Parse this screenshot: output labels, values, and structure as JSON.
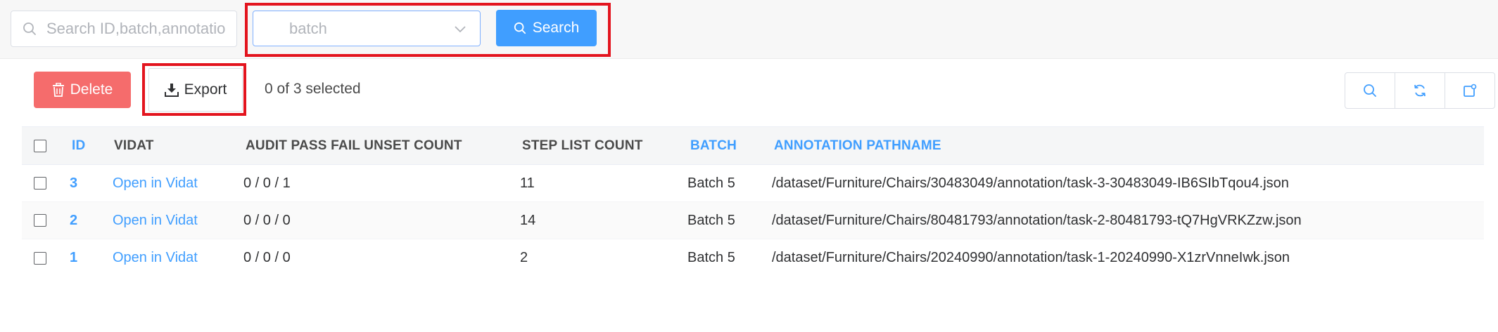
{
  "search": {
    "placeholder": "Search ID,batch,annotatio",
    "select_placeholder": "batch",
    "search_button": "Search"
  },
  "toolbar": {
    "delete_label": "Delete",
    "export_label": "Export",
    "selection_status": "0 of 3 selected"
  },
  "table": {
    "headers": {
      "id": "ID",
      "vidat": "VIDAT",
      "audit": "AUDIT PASS FAIL UNSET COUNT",
      "step": "STEP LIST COUNT",
      "batch": "BATCH",
      "pathname": "ANNOTATION PATHNAME"
    },
    "rows": [
      {
        "id": "3",
        "vidat": "Open in Vidat",
        "audit": "0 / 0 / 1",
        "step": "11",
        "batch": "Batch 5",
        "pathname": "/dataset/Furniture/Chairs/30483049/annotation/task-3-30483049-IB6SIbTqou4.json"
      },
      {
        "id": "2",
        "vidat": "Open in Vidat",
        "audit": "0 / 0 / 0",
        "step": "14",
        "batch": "Batch 5",
        "pathname": "/dataset/Furniture/Chairs/80481793/annotation/task-2-80481793-tQ7HgVRKZzw.json"
      },
      {
        "id": "1",
        "vidat": "Open in Vidat",
        "audit": "0 / 0 / 0",
        "step": "2",
        "batch": "Batch 5",
        "pathname": "/dataset/Furniture/Chairs/20240990/annotation/task-1-20240990-X1zrVnneIwk.json"
      }
    ]
  },
  "colors": {
    "primary": "#409eff",
    "danger": "#f56c6c",
    "highlight_frame": "#e3141e"
  },
  "icons": {
    "search_field": "search-icon",
    "select": "chevron-down-icon",
    "search_button": "search-icon",
    "delete": "trash-icon",
    "export": "download-icon",
    "tools": [
      "search-icon",
      "refresh-icon",
      "columns-icon"
    ]
  }
}
